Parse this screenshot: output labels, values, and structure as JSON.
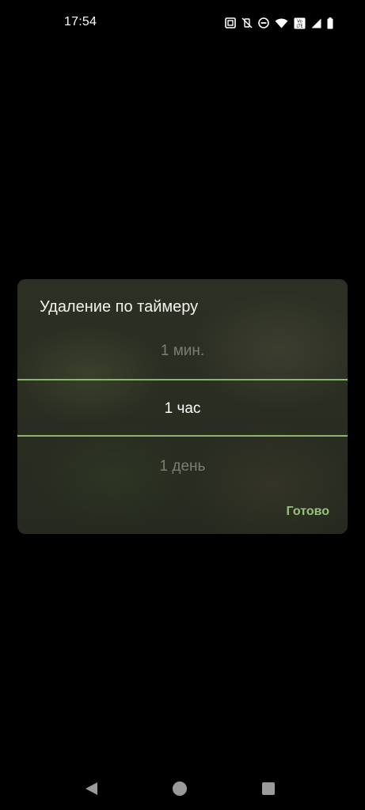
{
  "status_bar": {
    "time": "17:54",
    "icons": [
      "nfc-icon",
      "vibrate-off-icon",
      "do-not-disturb-icon",
      "wifi-icon",
      "volte-icon",
      "signal-icon",
      "battery-icon"
    ],
    "volte_label_top": "Vo",
    "volte_label_bottom": "LTE"
  },
  "dialog": {
    "title": "Удаление по таймеру",
    "picker": {
      "previous": "1 мин.",
      "selected": "1 час",
      "next": "1 день"
    },
    "done_label": "Готово",
    "accent_color": "#8bb56b"
  },
  "nav_bar": {
    "buttons": [
      "back-icon",
      "home-icon",
      "recents-icon"
    ]
  }
}
